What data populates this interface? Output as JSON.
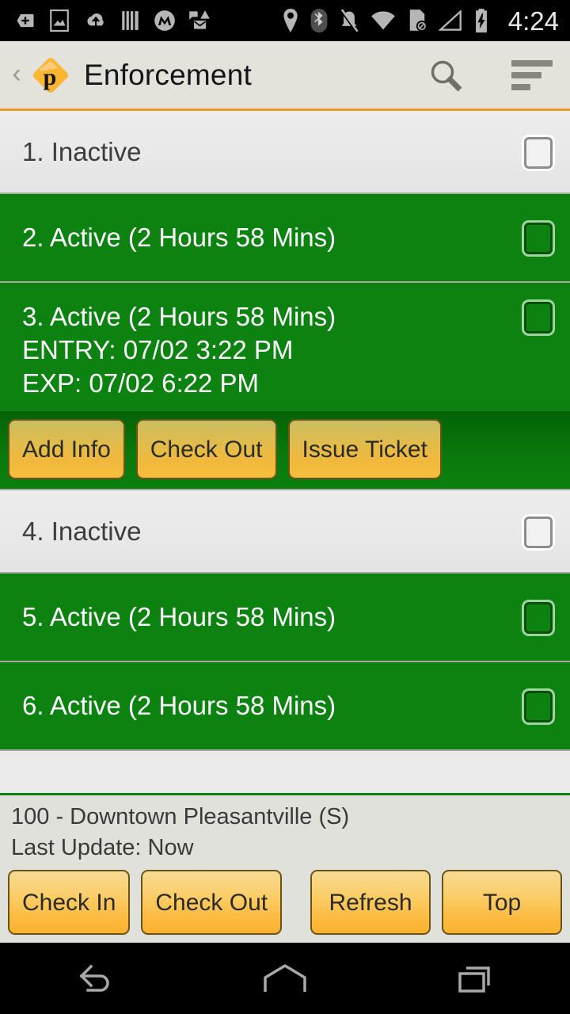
{
  "status_bar": {
    "icons": [
      "plus-badge-icon",
      "image-icon",
      "cloud-upload-icon",
      "barcode-icon",
      "motorola-icon",
      "sms-alert-icon",
      "location-icon",
      "bluetooth-icon",
      "ringer-muted-icon",
      "wifi-icon",
      "no-sim-icon",
      "signal-icon",
      "battery-charging-icon"
    ],
    "clock": "4:24"
  },
  "header": {
    "back_label": "‹",
    "logo_letter": "p",
    "logo_name": "parking-app-logo",
    "title": "Enforcement",
    "search_icon": "search-icon",
    "menu_icon": "sort-menu-icon",
    "accent_color": "#ef9b2a"
  },
  "list": {
    "rows": [
      {
        "title": "1. Inactive",
        "state": "inactive",
        "expanded": false,
        "checked": false
      },
      {
        "title": "2. Active (2 Hours 58 Mins)",
        "state": "active",
        "expanded": false,
        "checked": false
      },
      {
        "title": "3. Active (2 Hours 58 Mins)",
        "entry": "ENTRY: 07/02 3:22 PM",
        "expires": "EXP: 07/02 6:22 PM",
        "state": "active",
        "expanded": true,
        "checked": false,
        "actions": [
          "Add Info",
          "Check Out",
          "Issue Ticket"
        ]
      },
      {
        "title": "4. Inactive",
        "state": "inactive",
        "expanded": false,
        "checked": false
      },
      {
        "title": "5. Active (2 Hours 58 Mins)",
        "state": "active",
        "expanded": false,
        "checked": false
      },
      {
        "title": "6. Active (2 Hours 58 Mins)",
        "state": "active",
        "expanded": false,
        "checked": false
      }
    ],
    "active_color": "#0c8211",
    "inactive_color": "#ebebeb"
  },
  "footer": {
    "zone": "100 - Downtown Pleasantville (S)",
    "last_update": "Last Update: Now",
    "buttons": {
      "check_in": "Check In",
      "check_out": "Check Out",
      "refresh": "Refresh",
      "top": "Top"
    }
  },
  "nav_bar": {
    "back": "back-nav-icon",
    "home": "home-nav-icon",
    "recents": "recents-nav-icon"
  }
}
